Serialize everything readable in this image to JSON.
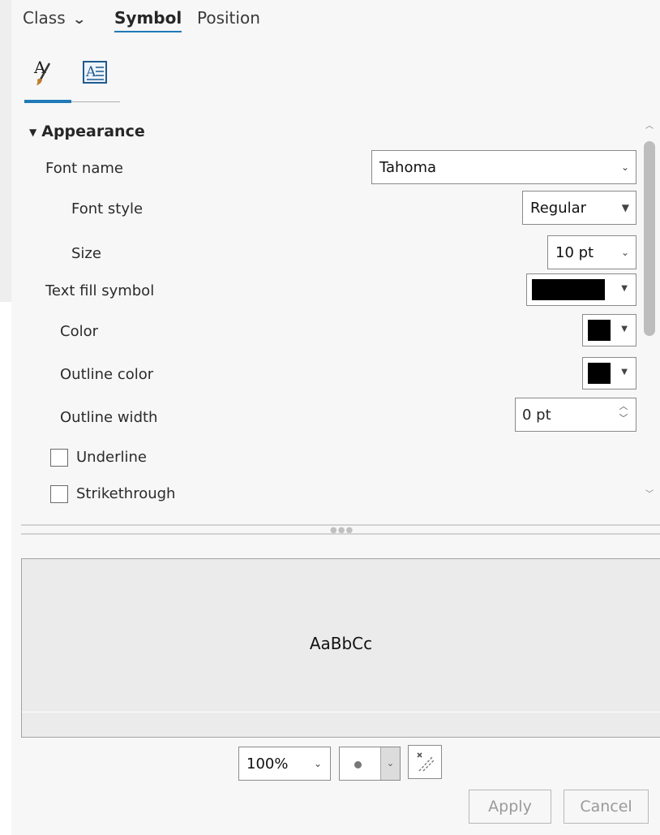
{
  "tabs": {
    "class": "Class",
    "symbol": "Symbol",
    "position": "Position"
  },
  "icon_tabs": [
    {
      "name": "text-symbol-brush-icon",
      "active": true
    },
    {
      "name": "text-frame-icon",
      "active": false
    }
  ],
  "appearance": {
    "section_title": "Appearance",
    "font_name_label": "Font name",
    "font_name_value": "Tahoma",
    "font_style_label": "Font style",
    "font_style_value": "Regular",
    "size_label": "Size",
    "size_value": "10 pt",
    "text_fill_label": "Text fill symbol",
    "color_label": "Color",
    "outline_color_label": "Outline color",
    "outline_width_label": "Outline width",
    "outline_width_value": "0 pt",
    "underline_label": "Underline",
    "strikethrough_label": "Strikethrough",
    "fill_color": "#000000",
    "color_value": "#000000",
    "outline_color_value": "#000000"
  },
  "preview": {
    "sample_text": "AaBbCc"
  },
  "bottom": {
    "zoom_value": "100%",
    "apply_label": "Apply",
    "cancel_label": "Cancel"
  },
  "accent_color": "#1f7ab8"
}
